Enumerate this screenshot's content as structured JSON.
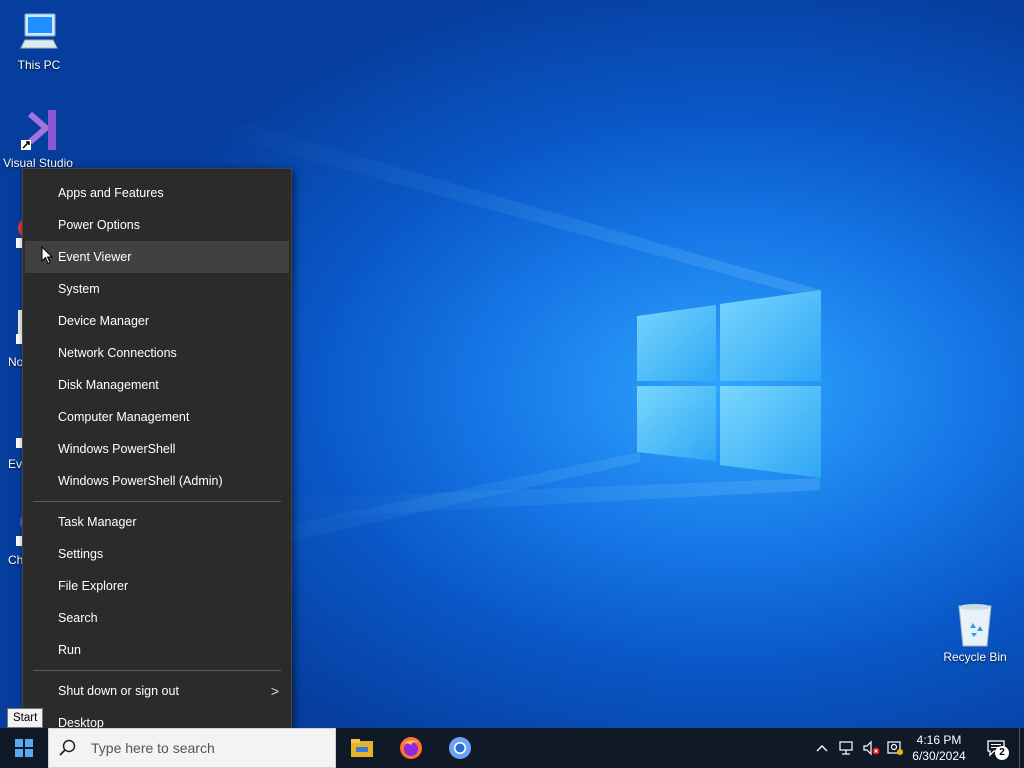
{
  "desktop": {
    "icons": {
      "this_pc": "This PC",
      "visual_studio": "Visual Studio",
      "recycle_bin": "Recycle Bin"
    },
    "partial_labels": {
      "item3": "No",
      "item4": "Ev",
      "item5": "Ch"
    }
  },
  "context_menu": {
    "group1": [
      "Apps and Features",
      "Power Options",
      "Event Viewer",
      "System",
      "Device Manager",
      "Network Connections",
      "Disk Management",
      "Computer Management",
      "Windows PowerShell",
      "Windows PowerShell (Admin)"
    ],
    "group2": [
      "Task Manager",
      "Settings",
      "File Explorer",
      "Search",
      "Run"
    ],
    "group3": [
      "Shut down or sign out",
      "Desktop"
    ],
    "submenu_arrow": ">",
    "hover_item": "Event Viewer"
  },
  "tooltip": {
    "text": "Start"
  },
  "taskbar": {
    "search_placeholder": "Type here to search",
    "pinned_apps": [
      "file-explorer-icon",
      "firefox-icon",
      "chromium-icon"
    ],
    "clock": {
      "time": "4:16 PM",
      "date": "6/30/2024"
    },
    "notification_count": "2"
  },
  "colors": {
    "menu_bg": "#2b2b2b",
    "menu_hover": "#414141",
    "taskbar_bg": "#101a26",
    "desktop_accent": "#1677e6"
  }
}
